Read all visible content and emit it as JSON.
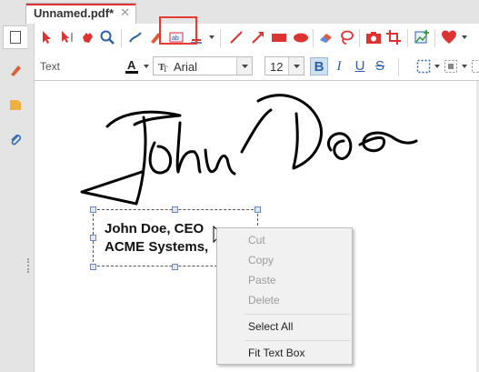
{
  "tab": {
    "title": "Unnamed.pdf*",
    "close": "✕"
  },
  "sidebar": {
    "items": [
      "pages-panel",
      "annotations-panel",
      "bookmarks-panel",
      "attachments-panel"
    ]
  },
  "toolbar1": {
    "tools": [
      "select",
      "select-text",
      "hand",
      "zoom",
      "pencil",
      "highlighter",
      "text-box",
      "stamp",
      "line",
      "arrow",
      "rectangle",
      "ellipse",
      "eraser",
      "lasso",
      "snapshot",
      "crop",
      "insert-image",
      "favorites"
    ],
    "selected": "text-box"
  },
  "toolbar2": {
    "mode_label": "Text",
    "font": "Arial",
    "font_size": "12",
    "bold": "B",
    "italic": "I",
    "underline": "U",
    "strikethrough": "S",
    "bold_active": true
  },
  "document": {
    "signature": "John Doe",
    "textbox_lines": [
      "John Doe, CEO",
      "ACME Systems,"
    ]
  },
  "context_menu": {
    "items": [
      {
        "label": "Cut",
        "enabled": false
      },
      {
        "label": "Copy",
        "enabled": false
      },
      {
        "label": "Paste",
        "enabled": false
      },
      {
        "label": "Delete",
        "enabled": false
      },
      {
        "label": "Select All",
        "enabled": true
      },
      {
        "label": "Fit Text Box",
        "enabled": true
      }
    ]
  },
  "colors": {
    "accent": "#d33333",
    "highlight": "#e53935",
    "text_color": "#111111"
  }
}
